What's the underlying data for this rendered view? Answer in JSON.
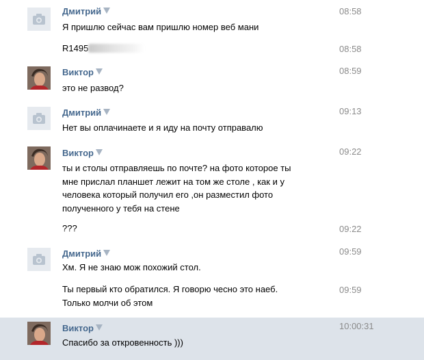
{
  "messages": [
    {
      "sender": "Дмитрий",
      "time": "08:58",
      "text": "Я пришлю сейчас вам пришлю номер веб мани",
      "avatar": "camera-icon"
    },
    {
      "sender": "",
      "time": "08:58",
      "text": "R1495",
      "avatar": ""
    },
    {
      "sender": "Виктор",
      "time": "08:59",
      "text": "это не развод?",
      "avatar": "user-photo"
    },
    {
      "sender": "Дмитрий",
      "time": "09:13",
      "text": "Нет вы оплачинаете и я иду на почту отправалю",
      "avatar": "camera-icon"
    },
    {
      "sender": "Виктор",
      "time": "09:22",
      "lines": [
        "ты и столы отправляешь по почте? на фото которое ты",
        "мне прислал планшет лежит на том же столе , как и у",
        "человека который получил его ,он разместил фото",
        "полученного у тебя на стене"
      ],
      "avatar": "user-photo"
    },
    {
      "sender": "",
      "time": "09:22",
      "text": "???",
      "avatar": ""
    },
    {
      "sender": "Дмитрий",
      "time": "09:59",
      "text": "Хм. Я не знаю мож похожий стол.",
      "avatar": "camera-icon"
    },
    {
      "sender": "",
      "time": "09:59",
      "lines": [
        "Ты первый кто обратился. Я говорю чесно это наеб.",
        "Только молчи об этом"
      ],
      "avatar": ""
    },
    {
      "sender": "Виктор",
      "time": "10:00:31",
      "text": "Спасибо за откровенность )))",
      "avatar": "user-photo",
      "highlighted": true
    }
  ],
  "colors": {
    "name": "#45688e",
    "time": "#8a8a8a",
    "highlight": "#dde3ea",
    "camera_bg": "#e6eaef"
  }
}
